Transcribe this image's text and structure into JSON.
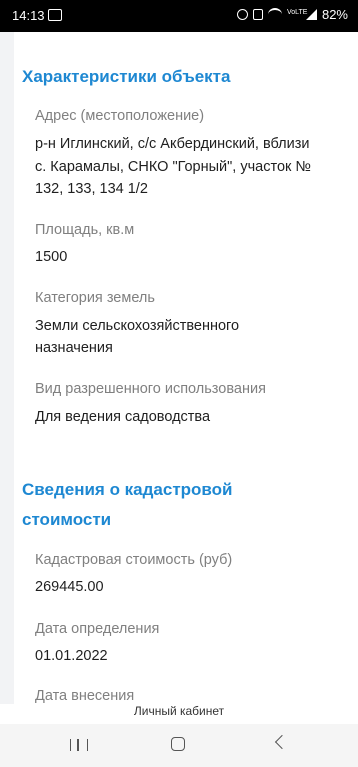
{
  "status_bar": {
    "time": "14:13",
    "battery": "82%",
    "volte": "VoLTE"
  },
  "characteristics": {
    "title": "Характеристики объекта",
    "address_label": "Адрес (местоположение)",
    "address_line1": "р-н Иглинский, с/с Акбердинский, вблизи",
    "address_line2": "с. Карамалы, СНКО \"Горный\", участок №",
    "address_line3": "132, 133, 134 1/2",
    "area_label": "Площадь, кв.м",
    "area_value": "1500",
    "category_label": "Категория земель",
    "category_line1": "Земли сельскохозяйственного",
    "category_line2": "назначения",
    "usage_label": "Вид разрешенного использования",
    "usage_value": "Для ведения садоводства"
  },
  "cadastral": {
    "title_line1": "Сведения о кадастровой",
    "title_line2": "стоимости",
    "cost_label": "Кадастровая стоимость (руб)",
    "cost_value": "269445.00",
    "date_label": "Дата определения",
    "date_value": "01.01.2022",
    "entry_label": "Дата внесения"
  },
  "footer": {
    "cabinet_link": "Личный кабинет"
  }
}
